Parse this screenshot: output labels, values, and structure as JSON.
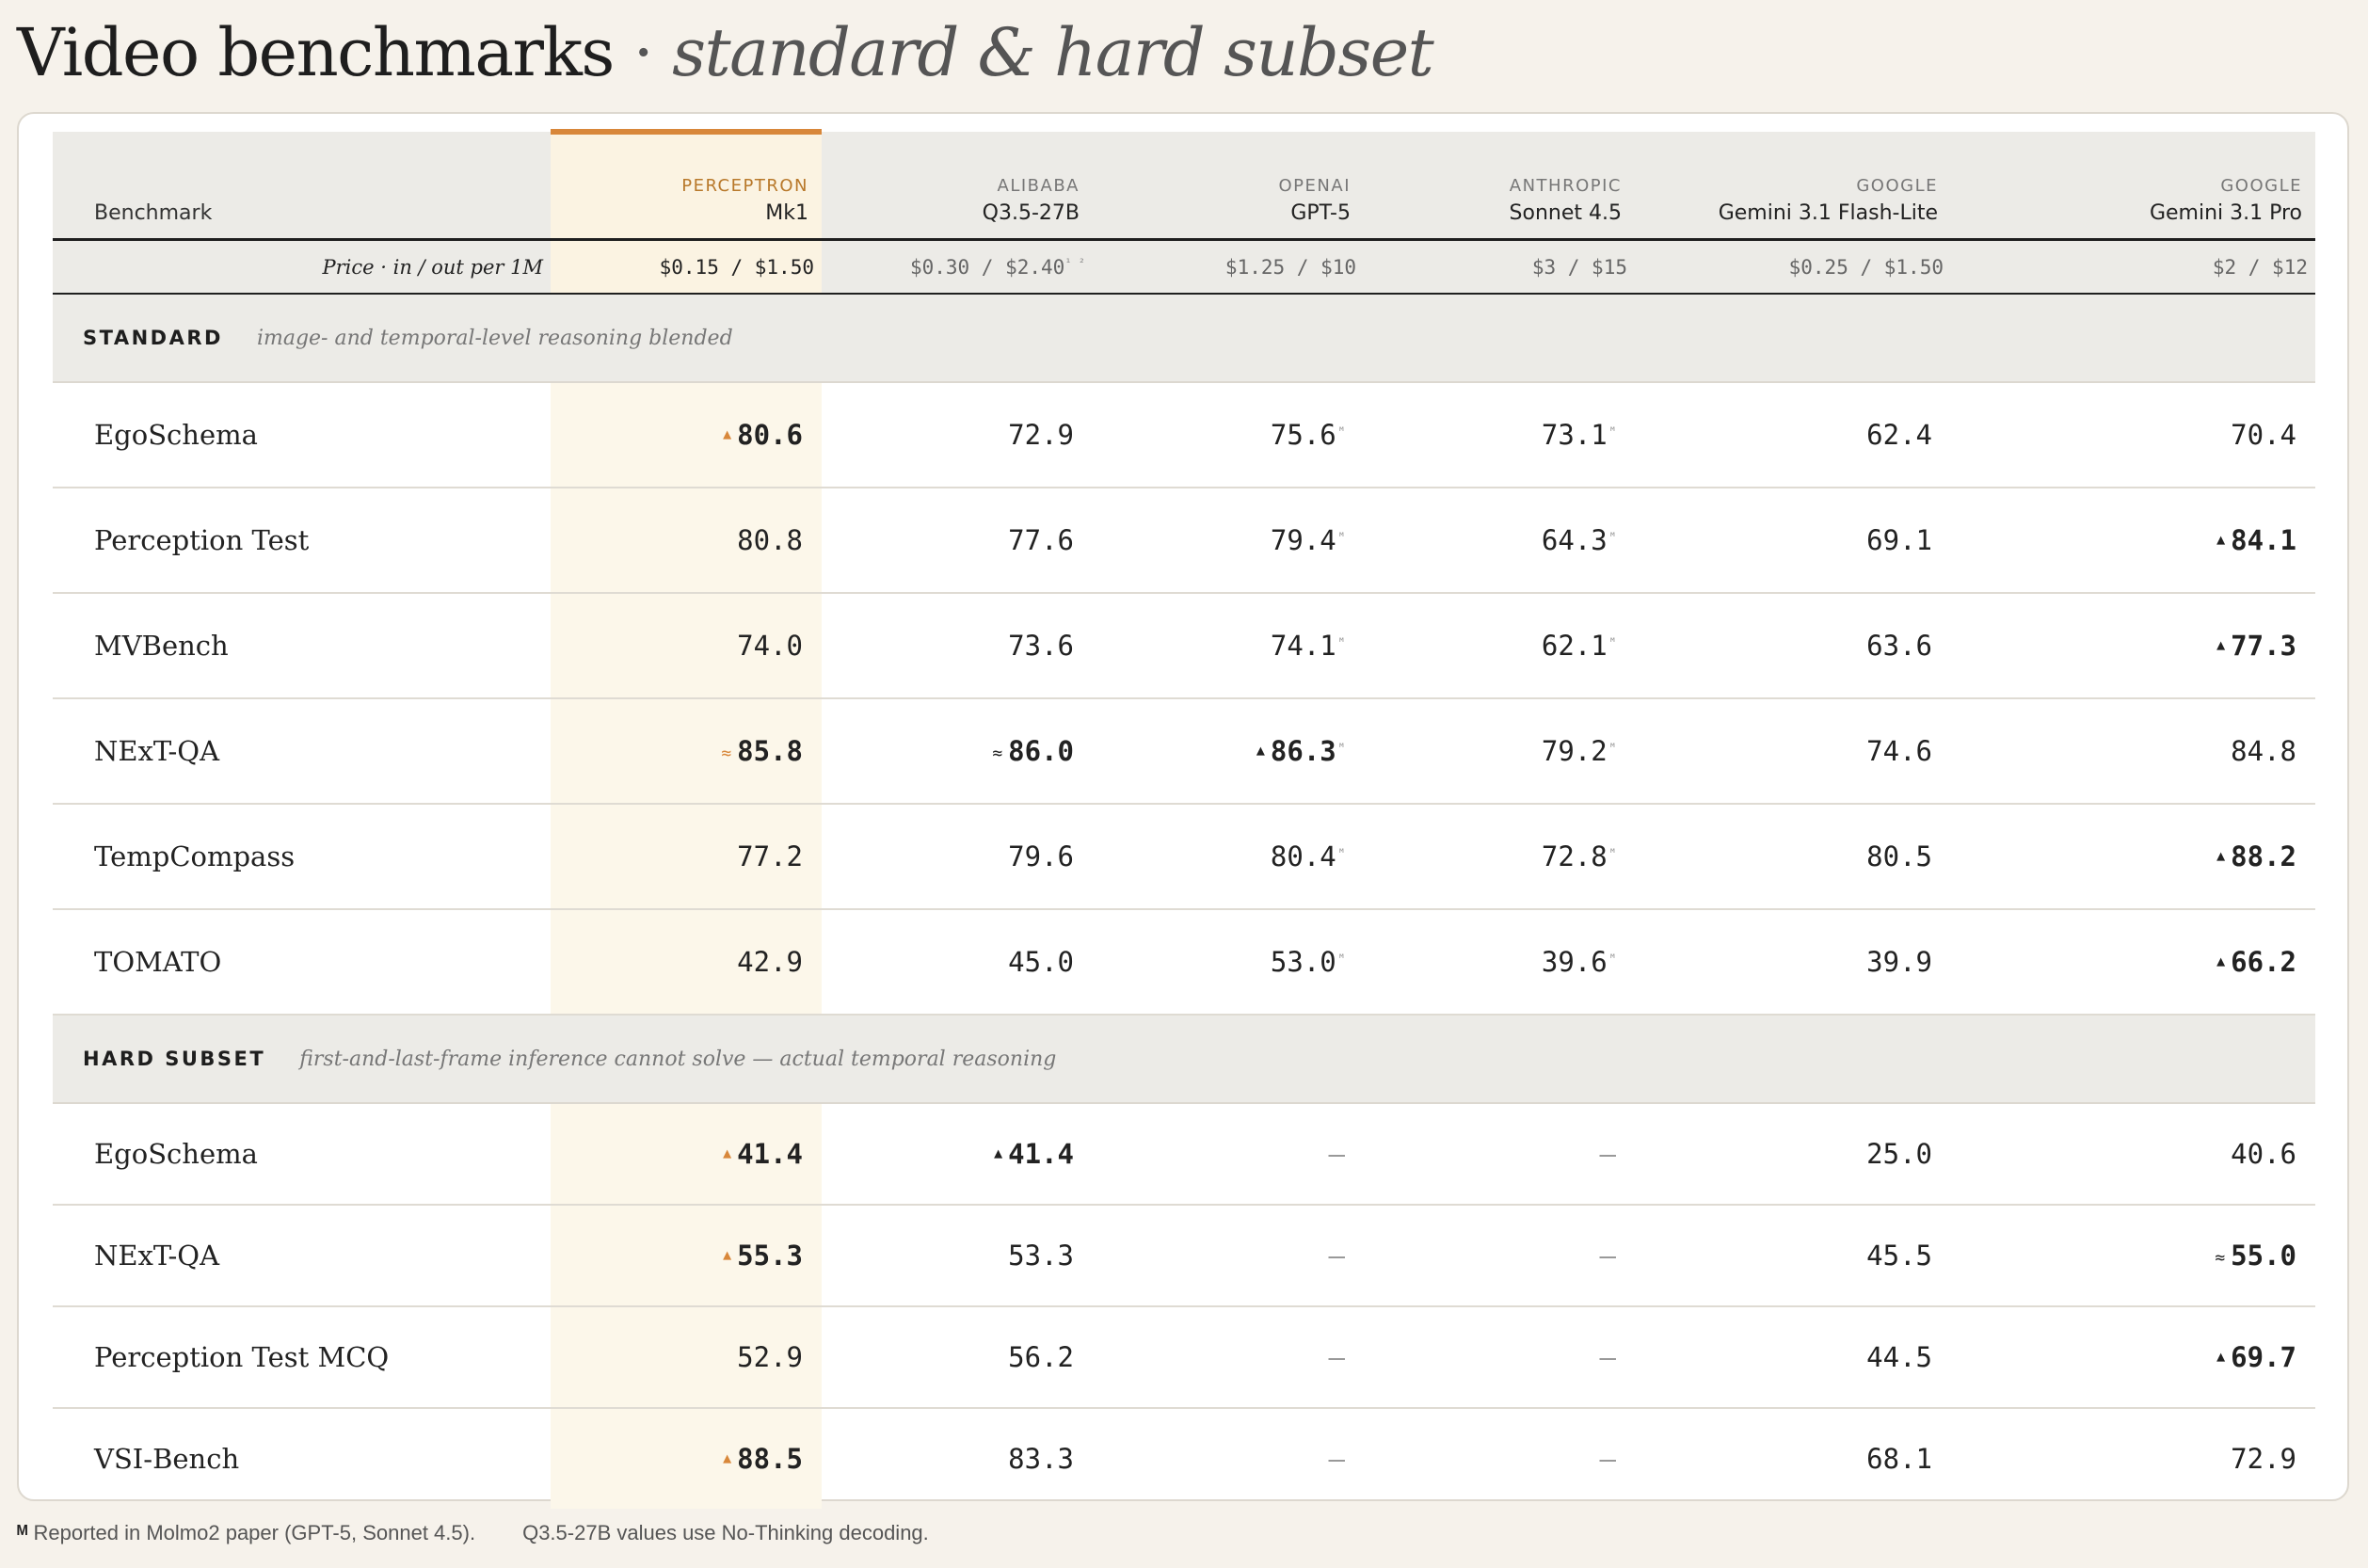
{
  "title": {
    "main": "Video benchmarks",
    "sep": " · ",
    "sub": "standard & hard subset"
  },
  "header": {
    "bench_label": "Benchmark",
    "price_label": "Price · in / out per 1M",
    "models": [
      {
        "vendor": "PERCEPTRON",
        "name": "Mk1",
        "price": "$0.15 / $1.50",
        "price_note": ""
      },
      {
        "vendor": "ALIBABA",
        "name": "Q3.5-27B",
        "price": "$0.30 / $2.40",
        "price_note": "¹ ²"
      },
      {
        "vendor": "OPENAI",
        "name": "GPT-5",
        "price": "$1.25 / $10",
        "price_note": ""
      },
      {
        "vendor": "ANTHROPIC",
        "name": "Sonnet 4.5",
        "price": "$3 / $15",
        "price_note": ""
      },
      {
        "vendor": "GOOGLE",
        "name": "Gemini 3.1 Flash-Lite",
        "price": "$0.25 / $1.50",
        "price_note": ""
      },
      {
        "vendor": "GOOGLE",
        "name": "Gemini 3.1 Pro",
        "price": "$2 / $12",
        "price_note": ""
      }
    ]
  },
  "sections": [
    {
      "name": "STANDARD",
      "desc": "image- and temporal-level reasoning blended",
      "rows": [
        {
          "bench": "EgoSchema",
          "cells": [
            {
              "v": "80.6",
              "mark": "▲",
              "best": true
            },
            {
              "v": "72.9"
            },
            {
              "v": "75.6",
              "note": "ᴹ"
            },
            {
              "v": "73.1",
              "note": "ᴹ"
            },
            {
              "v": "62.4"
            },
            {
              "v": "70.4"
            }
          ]
        },
        {
          "bench": "Perception Test",
          "cells": [
            {
              "v": "80.8"
            },
            {
              "v": "77.6"
            },
            {
              "v": "79.4",
              "note": "ᴹ"
            },
            {
              "v": "64.3",
              "note": "ᴹ"
            },
            {
              "v": "69.1"
            },
            {
              "v": "84.1",
              "mark": "▲",
              "best": true
            }
          ]
        },
        {
          "bench": "MVBench",
          "cells": [
            {
              "v": "74.0"
            },
            {
              "v": "73.6"
            },
            {
              "v": "74.1",
              "note": "ᴹ"
            },
            {
              "v": "62.1",
              "note": "ᴹ"
            },
            {
              "v": "63.6"
            },
            {
              "v": "77.3",
              "mark": "▲",
              "best": true
            }
          ]
        },
        {
          "bench": "NExT-QA",
          "cells": [
            {
              "v": "85.8",
              "mark": "≈",
              "best": true
            },
            {
              "v": "86.0",
              "mark": "≈",
              "best": true
            },
            {
              "v": "86.3",
              "mark": "▲",
              "best": true,
              "note": "ᴹ"
            },
            {
              "v": "79.2",
              "note": "ᴹ"
            },
            {
              "v": "74.6"
            },
            {
              "v": "84.8"
            }
          ]
        },
        {
          "bench": "TempCompass",
          "cells": [
            {
              "v": "77.2"
            },
            {
              "v": "79.6"
            },
            {
              "v": "80.4",
              "note": "ᴹ"
            },
            {
              "v": "72.8",
              "note": "ᴹ"
            },
            {
              "v": "80.5"
            },
            {
              "v": "88.2",
              "mark": "▲",
              "best": true
            }
          ]
        },
        {
          "bench": "TOMATO",
          "cells": [
            {
              "v": "42.9"
            },
            {
              "v": "45.0"
            },
            {
              "v": "53.0",
              "note": "ᴹ"
            },
            {
              "v": "39.6",
              "note": "ᴹ"
            },
            {
              "v": "39.9"
            },
            {
              "v": "66.2",
              "mark": "▲",
              "best": true
            }
          ]
        }
      ]
    },
    {
      "name": "HARD SUBSET",
      "desc": "first-and-last-frame inference cannot solve — actual temporal reasoning",
      "rows": [
        {
          "bench": "EgoSchema",
          "cells": [
            {
              "v": "41.4",
              "mark": "▲",
              "best": true
            },
            {
              "v": "41.4",
              "mark": "▲",
              "best": true
            },
            {
              "v": "—",
              "dash": true
            },
            {
              "v": "—",
              "dash": true
            },
            {
              "v": "25.0"
            },
            {
              "v": "40.6"
            }
          ]
        },
        {
          "bench": "NExT-QA",
          "cells": [
            {
              "v": "55.3",
              "mark": "▲",
              "best": true
            },
            {
              "v": "53.3"
            },
            {
              "v": "—",
              "dash": true
            },
            {
              "v": "—",
              "dash": true
            },
            {
              "v": "45.5"
            },
            {
              "v": "55.0",
              "mark": "≈",
              "best": true
            }
          ]
        },
        {
          "bench": "Perception Test MCQ",
          "cells": [
            {
              "v": "52.9"
            },
            {
              "v": "56.2"
            },
            {
              "v": "—",
              "dash": true
            },
            {
              "v": "—",
              "dash": true
            },
            {
              "v": "44.5"
            },
            {
              "v": "69.7",
              "mark": "▲",
              "best": true
            }
          ]
        },
        {
          "bench": "VSI-Bench",
          "cells": [
            {
              "v": "88.5",
              "mark": "▲",
              "best": true
            },
            {
              "v": "83.3"
            },
            {
              "v": "—",
              "dash": true
            },
            {
              "v": "—",
              "dash": true
            },
            {
              "v": "68.1"
            },
            {
              "v": "72.9"
            }
          ]
        }
      ]
    }
  ],
  "footer": {
    "note1_mark": "ᴹ",
    "note1": "Reported in Molmo2 paper (GPT-5, Sonnet 4.5).",
    "note2": "Q3.5-27B values use No-Thinking decoding."
  },
  "colors": {
    "accent": "#d8873a",
    "mk_column": "#fcf7ea",
    "header_bg": "#ecebe7",
    "page_bg": "#f6f2eb"
  }
}
